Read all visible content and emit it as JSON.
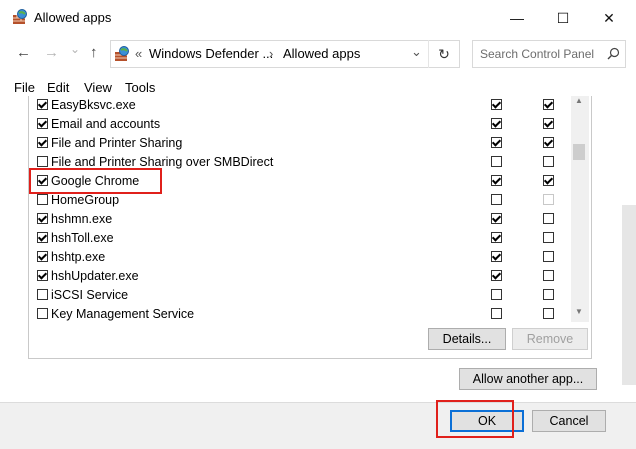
{
  "window": {
    "title": "Allowed apps",
    "controls": {
      "minimize": "—",
      "maximize": "☐",
      "close": "✕"
    }
  },
  "nav": {
    "back": "←",
    "forward": "→",
    "dropdown": "⌄",
    "up": "↑",
    "address": {
      "prefix": "«",
      "crumb1": "Windows Defender ...",
      "sep": "›",
      "crumb2": "Allowed apps",
      "dropdown": "⌄",
      "refresh": "↻"
    },
    "search": {
      "placeholder": "Search Control Panel",
      "icon": "search-icon"
    }
  },
  "menubar": {
    "items": [
      "File",
      "Edit",
      "View",
      "Tools"
    ]
  },
  "app_list": [
    {
      "name": "EasyBksvc.exe",
      "enabled": true,
      "private": true,
      "public": true
    },
    {
      "name": "Email and accounts",
      "enabled": true,
      "private": true,
      "public": true
    },
    {
      "name": "File and Printer Sharing",
      "enabled": true,
      "private": true,
      "public": true
    },
    {
      "name": "File and Printer Sharing over SMBDirect",
      "enabled": false,
      "private": false,
      "public": false
    },
    {
      "name": "Google Chrome",
      "enabled": true,
      "private": true,
      "public": true
    },
    {
      "name": "HomeGroup",
      "enabled": false,
      "private": false,
      "public": false,
      "public_disabled": true
    },
    {
      "name": "hshmn.exe",
      "enabled": true,
      "private": true,
      "public": false
    },
    {
      "name": "hshToll.exe",
      "enabled": true,
      "private": true,
      "public": false
    },
    {
      "name": "hshtp.exe",
      "enabled": true,
      "private": true,
      "public": false
    },
    {
      "name": "hshUpdater.exe",
      "enabled": true,
      "private": true,
      "public": false
    },
    {
      "name": "iSCSI Service",
      "enabled": false,
      "private": false,
      "public": false
    },
    {
      "name": "Key Management Service",
      "enabled": false,
      "private": false,
      "public": false
    }
  ],
  "buttons": {
    "details": "Details...",
    "remove": "Remove",
    "allow_another": "Allow another app...",
    "ok": "OK",
    "cancel": "Cancel"
  },
  "highlight_color": "#e0201b",
  "accent_color": "#0b6fd6"
}
